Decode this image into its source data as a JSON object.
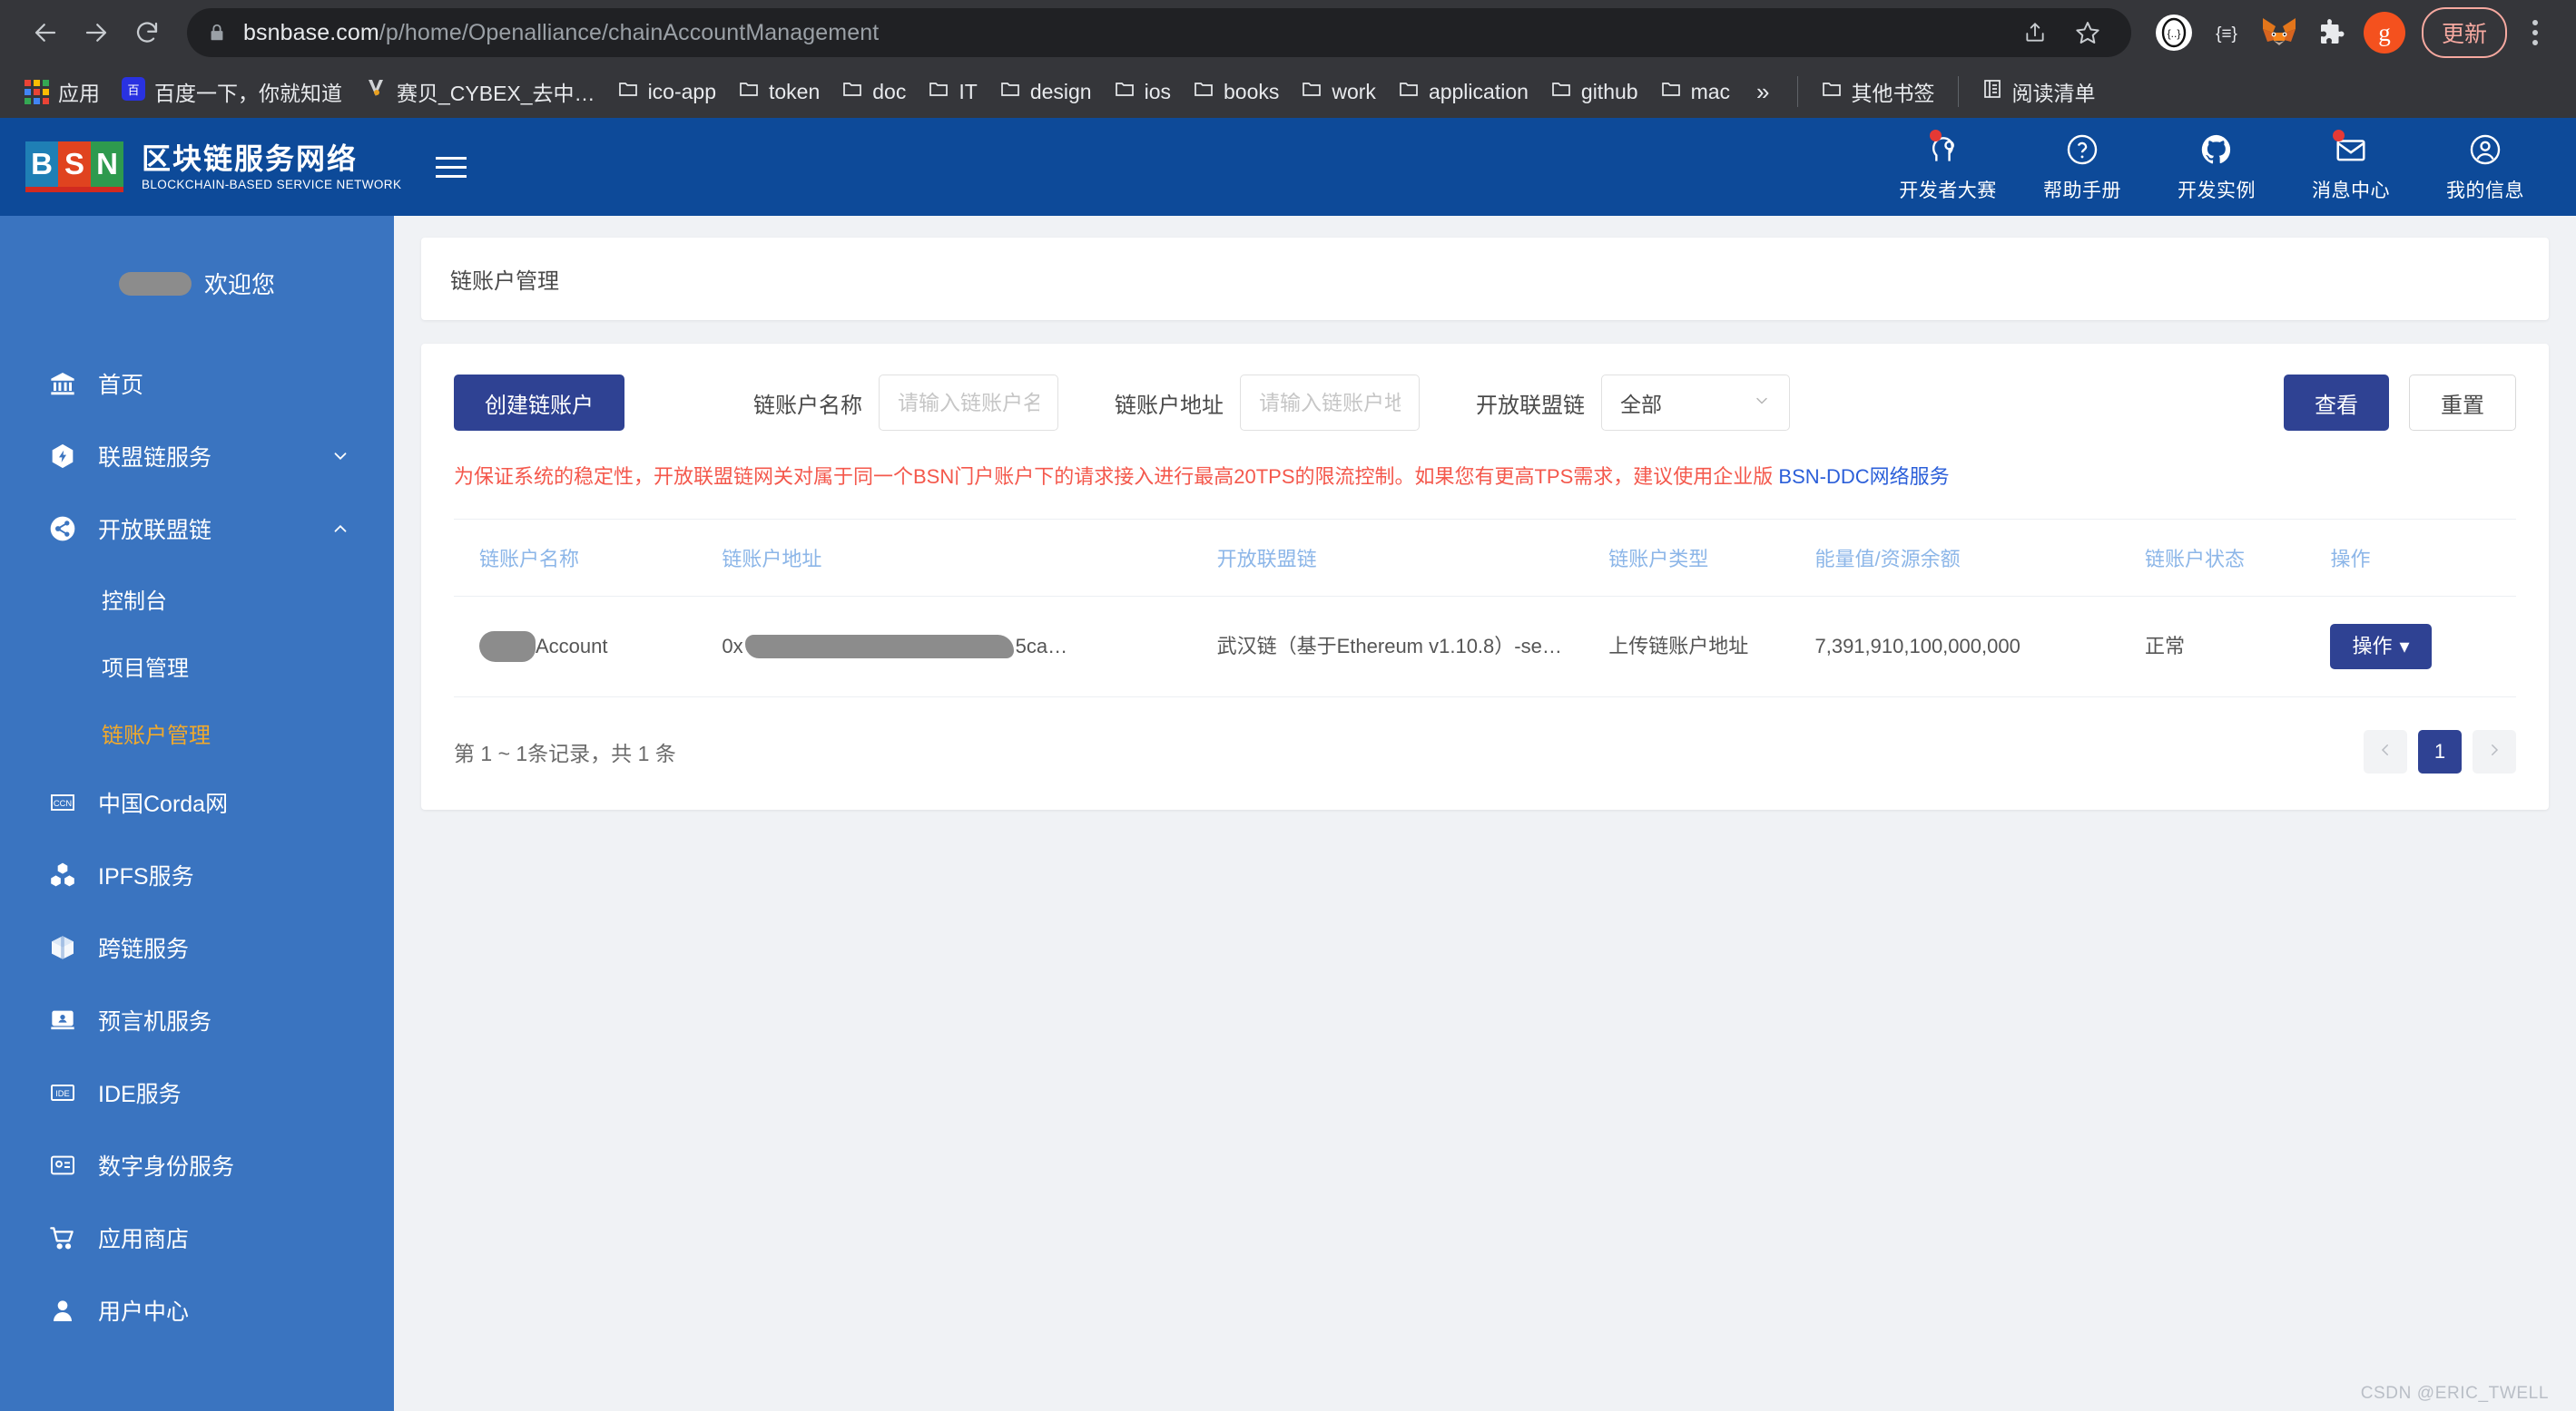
{
  "browser": {
    "back_icon": "back-arrow-icon",
    "forward_icon": "forward-arrow-icon",
    "reload_icon": "reload-icon",
    "url_domain": "bsnbase.com",
    "url_path": "/p/home/Openalliance/chainAccountManagement",
    "share_icon": "share-icon",
    "bookmark_icon": "star-icon",
    "extensions": [
      {
        "name": "circle-brackets-extension",
        "glyph": "{…}"
      },
      {
        "name": "json-viewer-extension",
        "glyph": "{≡}"
      },
      {
        "name": "metamask-extension",
        "glyph": "🦊"
      },
      {
        "name": "puzzle-extension",
        "glyph": "🧩"
      },
      {
        "name": "grammarly-extension",
        "glyph": "g"
      }
    ],
    "update_label": "更新",
    "menu_icon": "kebab-menu-icon"
  },
  "bookmarks": {
    "apps_label": "应用",
    "items": [
      {
        "label": "百度一下，你就知道",
        "icon": "baidu-icon"
      },
      {
        "label": "赛贝_CYBEX_去中…",
        "icon": "cybex-icon"
      },
      {
        "label": "ico-app",
        "icon": "folder-icon"
      },
      {
        "label": "token",
        "icon": "folder-icon"
      },
      {
        "label": "doc",
        "icon": "folder-icon"
      },
      {
        "label": "IT",
        "icon": "folder-icon"
      },
      {
        "label": "design",
        "icon": "folder-icon"
      },
      {
        "label": "ios",
        "icon": "folder-icon"
      },
      {
        "label": "books",
        "icon": "folder-icon"
      },
      {
        "label": "work",
        "icon": "folder-icon"
      },
      {
        "label": "application",
        "icon": "folder-icon"
      },
      {
        "label": "github",
        "icon": "folder-icon"
      },
      {
        "label": "mac",
        "icon": "folder-icon"
      }
    ],
    "overflow_label": "»",
    "other_bookmarks": "其他书签",
    "reading_list": "阅读清单"
  },
  "header": {
    "logo_letters": [
      "B",
      "S",
      "N"
    ],
    "brand_cn": "区块链服务网络",
    "brand_en": "BLOCKCHAIN-BASED SERVICE NETWORK",
    "menu_icon": "hamburger-icon",
    "nav": [
      {
        "label": "开发者大赛",
        "icon": "lightbulb-head-icon",
        "badge": true
      },
      {
        "label": "帮助手册",
        "icon": "question-circle-icon",
        "badge": false
      },
      {
        "label": "开发实例",
        "icon": "github-icon",
        "badge": false
      },
      {
        "label": "消息中心",
        "icon": "envelope-icon",
        "badge": true
      },
      {
        "label": "我的信息",
        "icon": "user-circle-icon",
        "badge": false
      }
    ]
  },
  "sidebar": {
    "welcome_text": "欢迎您",
    "items": [
      {
        "label": "首页",
        "icon": "bank-icon",
        "expandable": false
      },
      {
        "label": "联盟链服务",
        "icon": "flash-hex-icon",
        "expandable": true,
        "expanded": false
      },
      {
        "label": "开放联盟链",
        "icon": "share-nodes-icon",
        "expandable": true,
        "expanded": true
      },
      {
        "label": "中国Corda网",
        "icon": "ccn-icon",
        "expandable": false
      },
      {
        "label": "IPFS服务",
        "icon": "ipfs-nodes-icon",
        "expandable": false
      },
      {
        "label": "跨链服务",
        "icon": "cube-icon",
        "expandable": false
      },
      {
        "label": "预言机服务",
        "icon": "oracle-laptop-icon",
        "expandable": false
      },
      {
        "label": "IDE服务",
        "icon": "ide-icon",
        "expandable": false
      },
      {
        "label": "数字身份服务",
        "icon": "id-card-icon",
        "expandable": false
      },
      {
        "label": "应用商店",
        "icon": "cart-icon",
        "expandable": false
      },
      {
        "label": "用户中心",
        "icon": "user-dot-icon",
        "expandable": false
      }
    ],
    "subitems": [
      {
        "label": "控制台",
        "active": false
      },
      {
        "label": "项目管理",
        "active": false
      },
      {
        "label": "链账户管理",
        "active": true
      }
    ]
  },
  "page": {
    "title": "链账户管理"
  },
  "filters": {
    "create_button": "创建链账户",
    "name_label": "链账户名称",
    "name_placeholder": "请输入链账户名称",
    "name_value": "",
    "address_label": "链账户地址",
    "address_placeholder": "请输入链账户地址",
    "address_value": "",
    "chain_label": "开放联盟链",
    "chain_value": "全部",
    "search_button": "查看",
    "reset_button": "重置"
  },
  "notice": {
    "text": "为保证系统的稳定性，开放联盟链网关对属于同一个BSN门户账户下的请求接入进行最高20TPS的限流控制。如果您有更高TPS需求，建议使用企业版 ",
    "link": "BSN-DDC网络服务"
  },
  "table": {
    "columns": [
      "链账户名称",
      "链账户地址",
      "开放联盟链",
      "链账户类型",
      "能量值/资源余额",
      "链账户状态",
      "操作"
    ],
    "rows": [
      {
        "name_redacted": true,
        "name_suffix": "Account",
        "address_prefix": "0x",
        "address_redacted": true,
        "address_suffix": "5ca…",
        "chain": "武汉链（基于Ethereum v1.10.8）-se…",
        "type": "上传链账户地址",
        "balance": "7,391,910,100,000,000",
        "status": "正常",
        "action_label": "操作"
      }
    ],
    "footer_count": "第 1 ~ 1条记录，共 1 条",
    "pager": {
      "prev_icon": "chevron-left-icon",
      "next_icon": "chevron-right-icon",
      "pages": [
        "1"
      ],
      "current": "1"
    }
  },
  "watermark": "CSDN @ERIC_TWELL",
  "colors": {
    "brand_blue": "#0d4a99",
    "sidebar_blue": "#3a74c0",
    "accent_button": "#2f4293",
    "active_sub": "#f0a92c",
    "notice_red": "#f4584c",
    "link_blue": "#2b5fd9",
    "table_header": "#8cb6e8"
  }
}
